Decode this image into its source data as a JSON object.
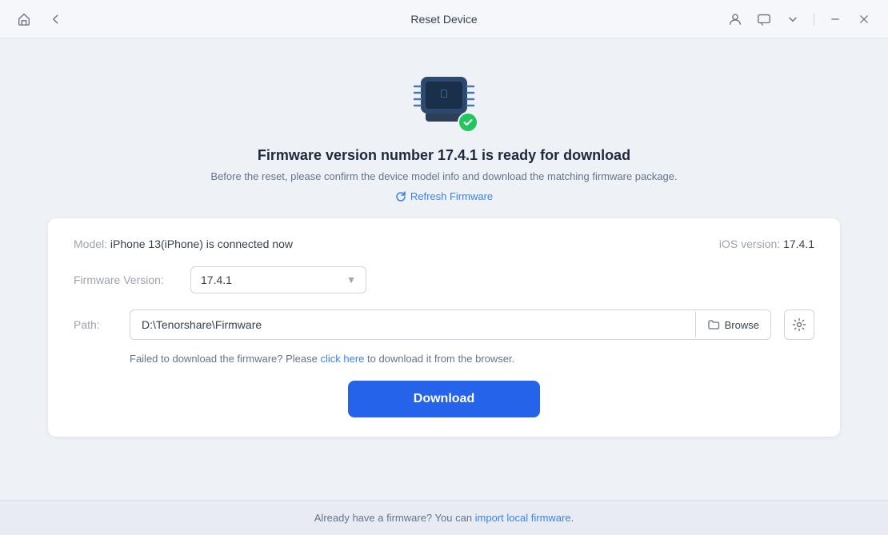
{
  "titlebar": {
    "title": "Reset Device",
    "home_label": "home",
    "back_label": "back"
  },
  "header": {
    "title": "Firmware version number 17.4.1 is ready for download",
    "subtitle": "Before the reset, please confirm the device model info and download the matching firmware package.",
    "refresh_label": "Refresh Firmware"
  },
  "card": {
    "model_label": "Model:",
    "model_value": "iPhone 13(iPhone) is connected now",
    "ios_label": "iOS version:",
    "ios_value": "17.4.1",
    "firmware_label": "Firmware Version:",
    "firmware_value": "17.4.1",
    "path_label": "Path:",
    "path_value": "D:\\Tenorshare\\Firmware",
    "browse_label": "Browse",
    "error_msg_pre": "Failed to download the firmware? Please ",
    "error_msg_link": "click here",
    "error_msg_post": " to download it from the browser.",
    "download_label": "Download"
  },
  "footer": {
    "text_pre": "Already have a firmware? You can ",
    "link_text": "import local firmware",
    "text_post": "."
  }
}
